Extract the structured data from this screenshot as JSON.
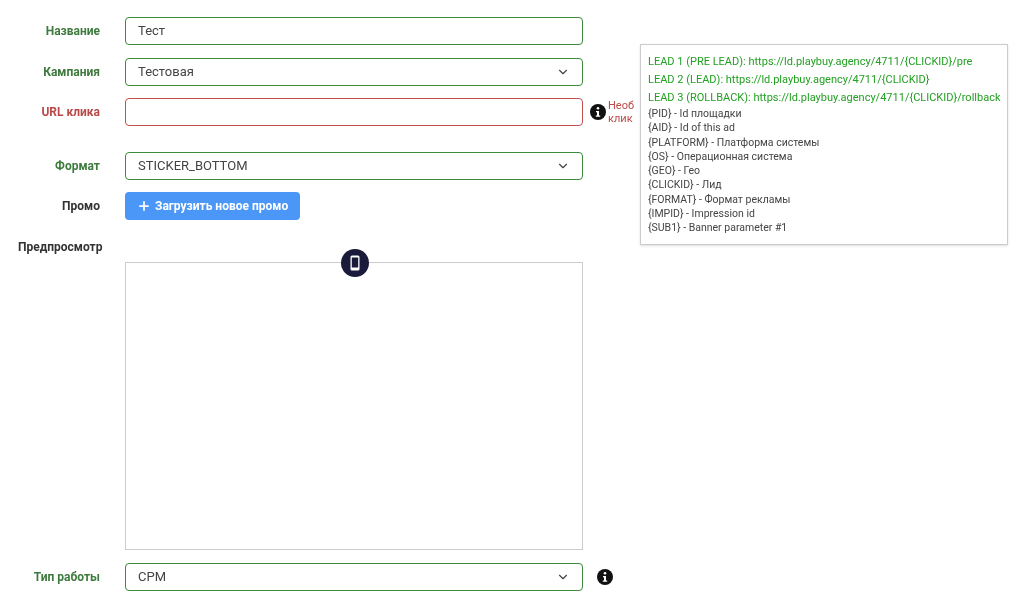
{
  "fields": [
    {
      "label": "Название",
      "kind": "input",
      "invalid": false,
      "value": "Тест"
    },
    {
      "label": "Кампания",
      "kind": "select",
      "invalid": false,
      "value": "Тестовая"
    },
    {
      "label": "URL клика",
      "kind": "input",
      "invalid": true,
      "hint": [
        "Необ",
        "клик"
      ],
      "info": true
    },
    {
      "label": "Формат",
      "kind": "select",
      "invalid": false,
      "value": "STICKER_BOTTOM"
    }
  ],
  "promo": {
    "label": "Промо",
    "button": "Загрузить новое промо"
  },
  "preview": {
    "label": "Предпросмотр"
  },
  "work_type": {
    "label": "Тип работы",
    "kind": "select",
    "invalid": false,
    "value": "CPM",
    "info": true
  },
  "tooltip": {
    "leads": [
      "LEAD 1 (PRE LEAD): https://ld.playbuy.agency/4711/{CLICKID}/pre",
      "LEAD 2 (LEAD): https://ld.playbuy.agency/4711/{CLICKID}",
      "LEAD 3 (ROLLBACK): https://ld.playbuy.agency/4711/{CLICKID}/rollback"
    ],
    "macros": [
      "{PID} - Id площадки",
      "{AID} - Id of this ad",
      "{PLATFORM} - Платформа системы",
      "{OS} - Операционная система",
      "{GEO} - Гео",
      "{CLICKID} - Лид",
      "{FORMAT} - Формат рекламы",
      "{IMPID} - Impression id",
      "{SUB1} - Banner parameter #1"
    ]
  }
}
